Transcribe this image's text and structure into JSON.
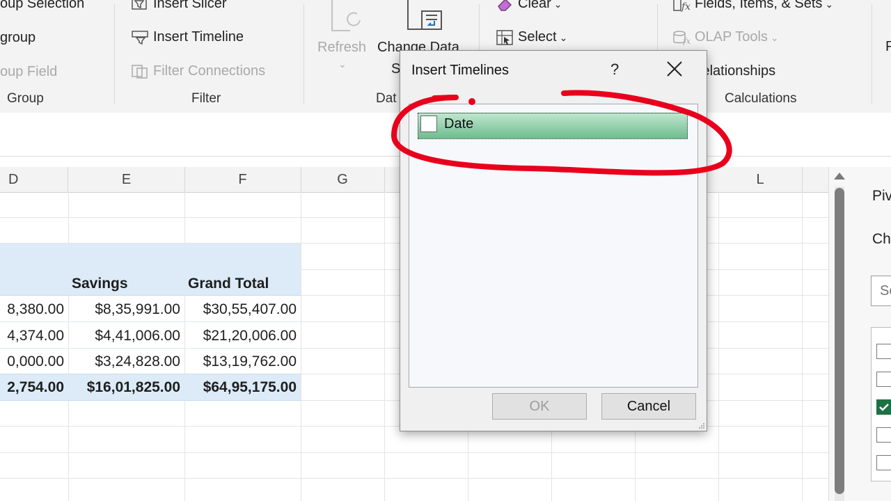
{
  "ribbon": {
    "group_items": [
      "oup Selection",
      "group",
      "oup Field"
    ],
    "group_label": "Group",
    "filter_items": [
      "Insert Slicer",
      "Insert Timeline",
      "Filter Connections"
    ],
    "filter_label": "Filter",
    "data_refresh": "Refresh",
    "data_change": "Change Data",
    "data_change_line2": "S",
    "data_label": "Dat",
    "actions_clear": "Clear",
    "actions_select": "Select",
    "calc_fields": "Fields, Items, & Sets",
    "calc_olap": "OLAP Tools",
    "calc_relationships": "Relationships",
    "calc_label": "Calculations",
    "far_right": "P"
  },
  "sheet": {
    "columns": [
      "D",
      "E",
      "F",
      "G",
      "L"
    ],
    "headers": [
      "Savings",
      "Grand Total"
    ],
    "rows": [
      [
        "8,380.00",
        "$8,35,991.00",
        "$30,55,407.00"
      ],
      [
        "4,374.00",
        "$4,41,006.00",
        "$21,20,006.00"
      ],
      [
        "0,000.00",
        "$3,24,828.00",
        "$13,19,762.00"
      ]
    ],
    "total_row": [
      "2,754.00",
      "$16,01,825.00",
      "$64,95,175.00"
    ]
  },
  "pane": {
    "title": "Piv",
    "subtitle": "Ch",
    "search_placeholder": "Se"
  },
  "dialog": {
    "title": "Insert Timelines",
    "help": "?",
    "item_label": "Date",
    "ok_label": "OK",
    "cancel_label": "Cancel"
  },
  "colors": {
    "accent_green": "#1e7145",
    "annotation_red": "#e8001c",
    "header_blue": "#dcebf7"
  }
}
